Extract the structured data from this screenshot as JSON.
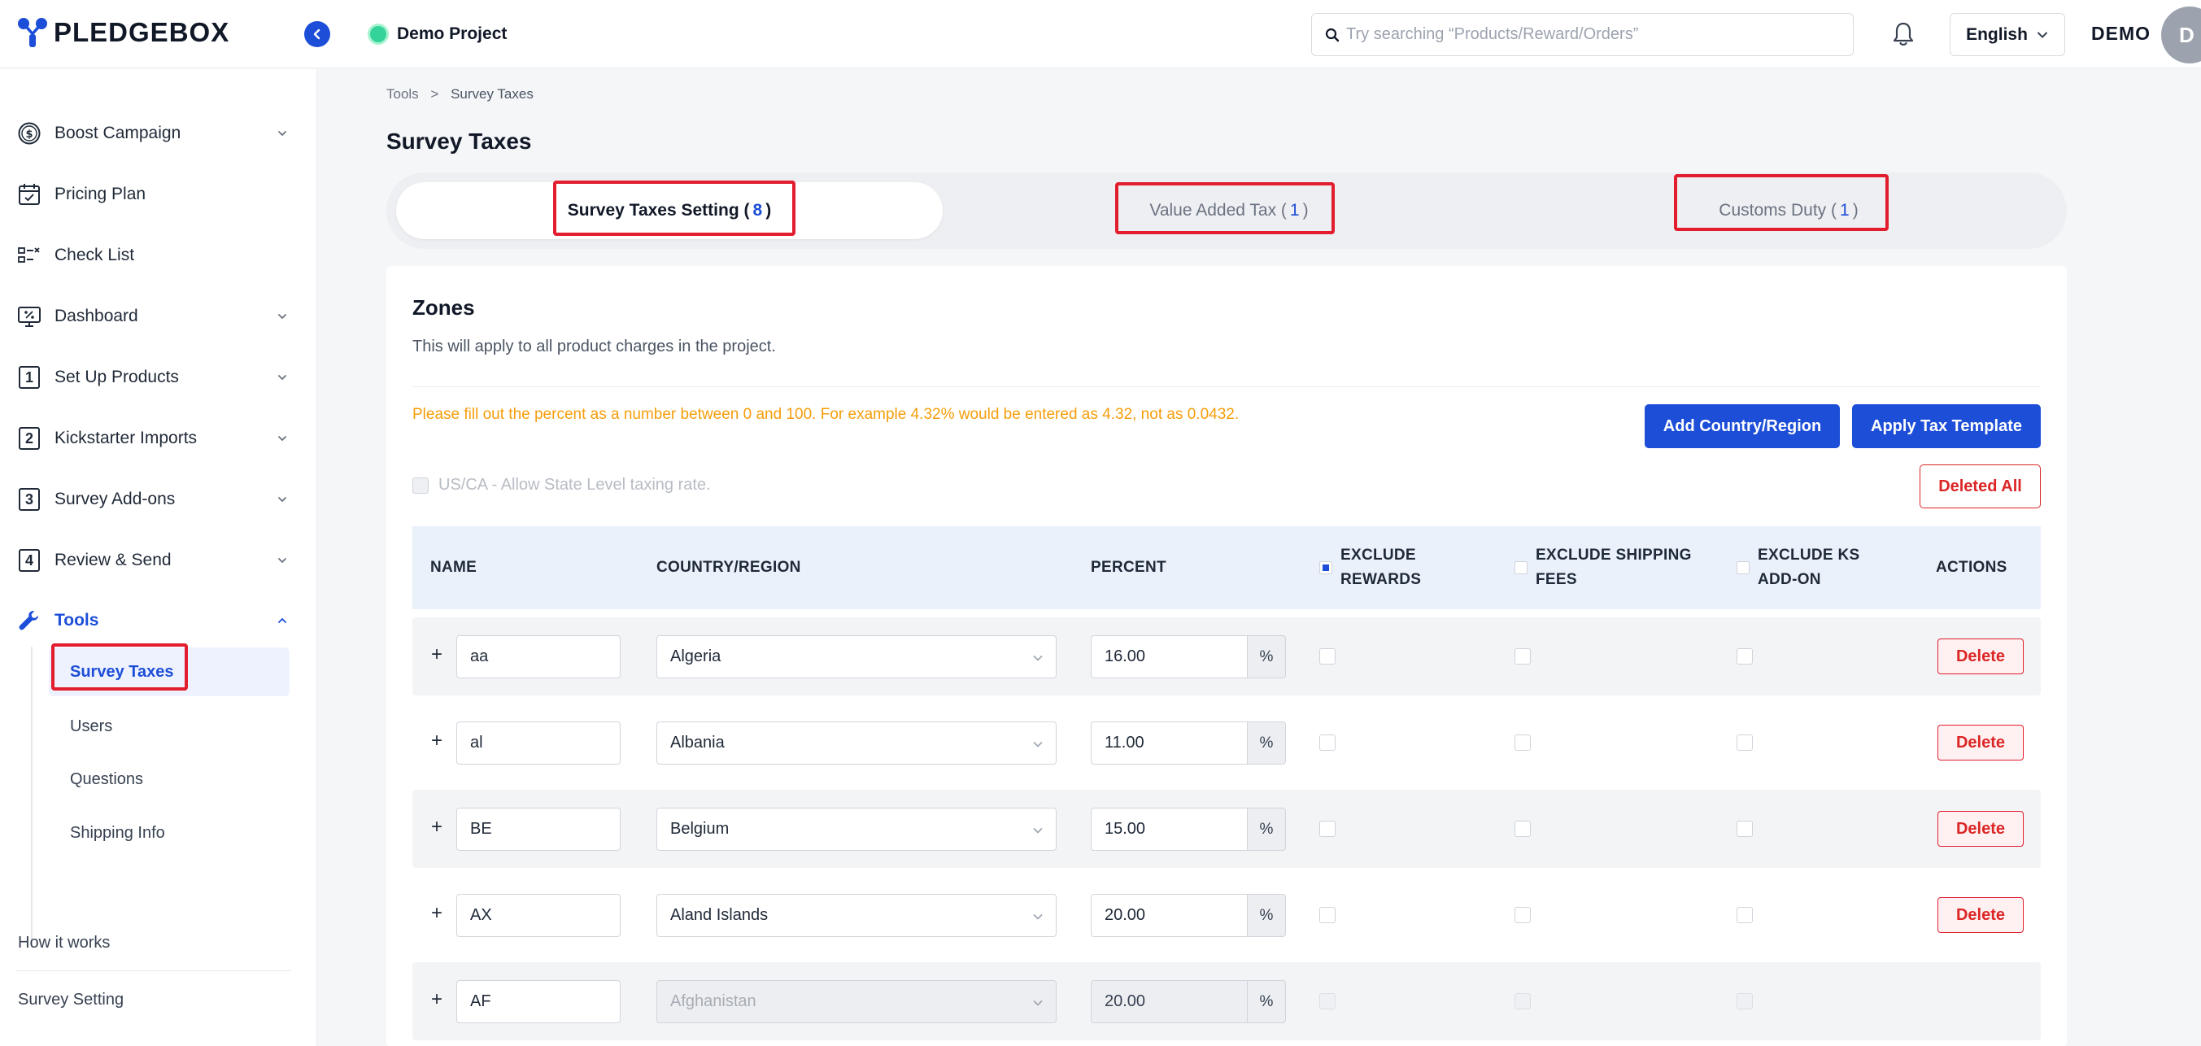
{
  "brand": {
    "name": "PLEDGEBOX",
    "accent": "#1d4ed8"
  },
  "header": {
    "project_name": "Demo Project",
    "search_placeholder": "Try searching “Products/Reward/Orders”",
    "language": "English",
    "user_name": "DEMO",
    "avatar_initial": "D"
  },
  "sidebar": {
    "items": [
      {
        "label": "Boost Campaign",
        "icon": "dollar-circle-icon",
        "expandable": true
      },
      {
        "label": "Pricing Plan",
        "icon": "calendar-check-icon",
        "expandable": false
      },
      {
        "label": "Check List",
        "icon": "checklist-icon",
        "expandable": false
      },
      {
        "label": "Dashboard",
        "icon": "monitor-percent-icon",
        "expandable": true
      },
      {
        "label": "Set Up Products",
        "icon": "number-1-icon",
        "number": "1",
        "expandable": true
      },
      {
        "label": "Kickstarter Imports",
        "icon": "number-2-icon",
        "number": "2",
        "expandable": true
      },
      {
        "label": "Survey Add-ons",
        "icon": "number-3-icon",
        "number": "3",
        "expandable": true
      },
      {
        "label": "Review & Send",
        "icon": "number-4-icon",
        "number": "4",
        "expandable": true
      },
      {
        "label": "Tools",
        "icon": "wrench-icon",
        "expandable": true,
        "active": true
      }
    ],
    "sub_items": [
      "Survey Taxes",
      "Users",
      "Questions",
      "Shipping Info"
    ],
    "footer_links": [
      "How it works",
      "Survey Setting"
    ]
  },
  "breadcrumb": {
    "root": "Tools",
    "separator": ">",
    "current": "Survey Taxes"
  },
  "page_title": "Survey Taxes",
  "tabs": [
    {
      "label": "Survey Taxes Setting (",
      "count": "8",
      "close": ")",
      "active": true
    },
    {
      "label": "Value Added Tax (",
      "count": "1",
      "close": ")",
      "active": false
    },
    {
      "label": "Customs Duty (",
      "count": "1",
      "close": ")",
      "active": false
    }
  ],
  "zones": {
    "title": "Zones",
    "description": "This will apply to all product charges in the project.",
    "warning": "Please fill out the percent as a number between 0 and 100. For example 4.32% would be entered as 4.32, not as 0.0432.",
    "add_button": "Add Country/Region",
    "template_button": "Apply Tax Template",
    "delete_all_button": "Deleted All",
    "state_level_label": "US/CA - Allow State Level taxing rate."
  },
  "table": {
    "columns": {
      "name": "NAME",
      "country": "COUNTRY/REGION",
      "percent": "PERCENT",
      "exclude_rewards_1": "EXCLUDE",
      "exclude_rewards_2": "REWARDS",
      "exclude_shipping_1": "EXCLUDE SHIPPING",
      "exclude_shipping_2": "FEES",
      "exclude_ks_1": "EXCLUDE KS",
      "exclude_ks_2": "ADD-ON",
      "actions": "ACTIONS"
    },
    "plus": "+",
    "percent_suffix": "%",
    "delete_label": "Delete",
    "rows": [
      {
        "name": "aa",
        "country": "Algeria",
        "percent": "16.00"
      },
      {
        "name": "al",
        "country": "Albania",
        "percent": "11.00"
      },
      {
        "name": "BE",
        "country": "Belgium",
        "percent": "15.00"
      },
      {
        "name": "AX",
        "country": "Aland Islands",
        "percent": "20.00"
      },
      {
        "name": "AF",
        "country": "Afghanistan",
        "percent": "20.00"
      }
    ]
  }
}
